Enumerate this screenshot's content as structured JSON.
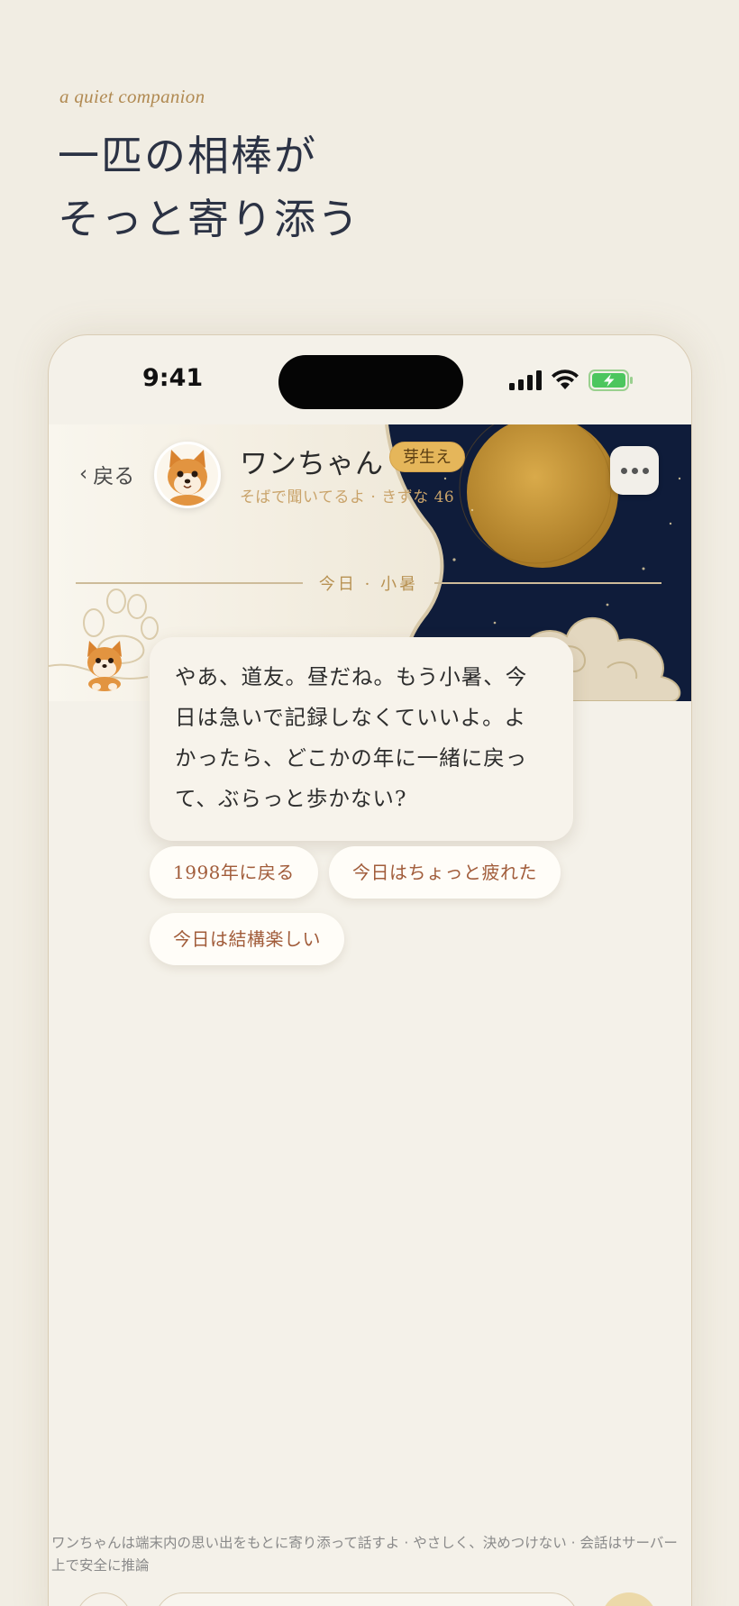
{
  "tagline": "a quiet companion",
  "headline": {
    "line1": "一匹の相棒が",
    "line2": "そっと寄り添う"
  },
  "status_bar": {
    "time": "9:41"
  },
  "header": {
    "back_label": "戻る",
    "pet_name": "ワンちゃん",
    "stage_badge": "芽生え",
    "subtitle": "そばで聞いてるよ · きずな 46"
  },
  "date_divider": "今日 · 小暑",
  "message": "やあ、道友。昼だね。もう小暑、今日は急いで記録しなくていいよ。よかったら、どこかの年に一緒に戻って、ぶらっと歩かない?",
  "quick_replies": [
    "1998年に戻る",
    "今日はちょっと疲れた",
    "今日は結構楽しい"
  ],
  "disclaimer": "ワンちゃんは端末内の思い出をもとに寄り添って話すよ · やさしく、決めつけない · 会話はサーバー上で安全に推論",
  "colors": {
    "accent_gold": "#e5b65a",
    "night_sky": "#0f1c3a",
    "chip_text": "#a15c3a"
  }
}
